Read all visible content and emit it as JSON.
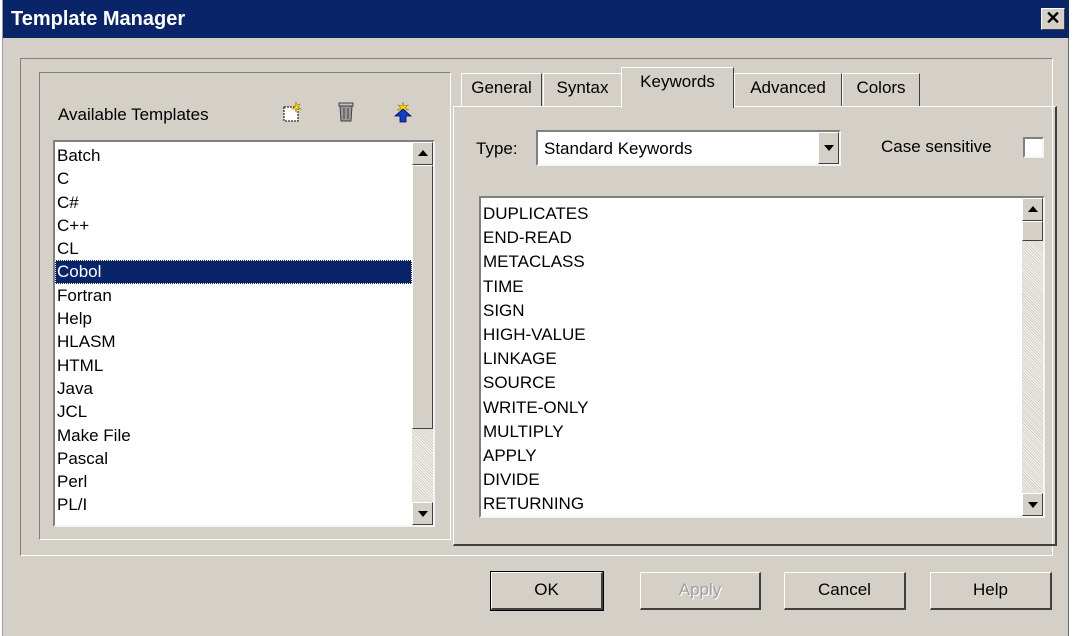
{
  "window": {
    "title": "Template Manager",
    "close_glyph": "✕"
  },
  "templates_panel": {
    "label": "Available Templates",
    "toolbar": [
      "new-template-icon",
      "delete-template-icon",
      "import-template-icon"
    ],
    "items": [
      "Batch",
      "C",
      "C#",
      "C++",
      "CL",
      "Cobol",
      "Fortran",
      "Help",
      "HLASM",
      "HTML",
      "Java",
      "JCL",
      "Make File",
      "Pascal",
      "Perl",
      "PL/I"
    ],
    "selected": "Cobol"
  },
  "tabs": [
    {
      "label": "General"
    },
    {
      "label": "Syntax"
    },
    {
      "label": "Keywords",
      "active": true
    },
    {
      "label": "Advanced"
    },
    {
      "label": "Colors"
    }
  ],
  "keywords": {
    "type_label": "Type:",
    "type_value": "Standard Keywords",
    "case_label": "Case sensitive",
    "case_checked": false,
    "items": [
      "DUPLICATES",
      "END-READ",
      "METACLASS",
      "TIME",
      "SIGN",
      "HIGH-VALUE",
      "LINKAGE",
      "SOURCE",
      "WRITE-ONLY",
      "MULTIPLY",
      "APPLY",
      "DIVIDE",
      "RETURNING"
    ]
  },
  "buttons": {
    "ok": "OK",
    "apply": "Apply",
    "cancel": "Cancel",
    "help": "Help"
  },
  "colors": {
    "titlebar": "#0a246a",
    "face": "#d4d0c8",
    "selection": "#0a246a"
  }
}
